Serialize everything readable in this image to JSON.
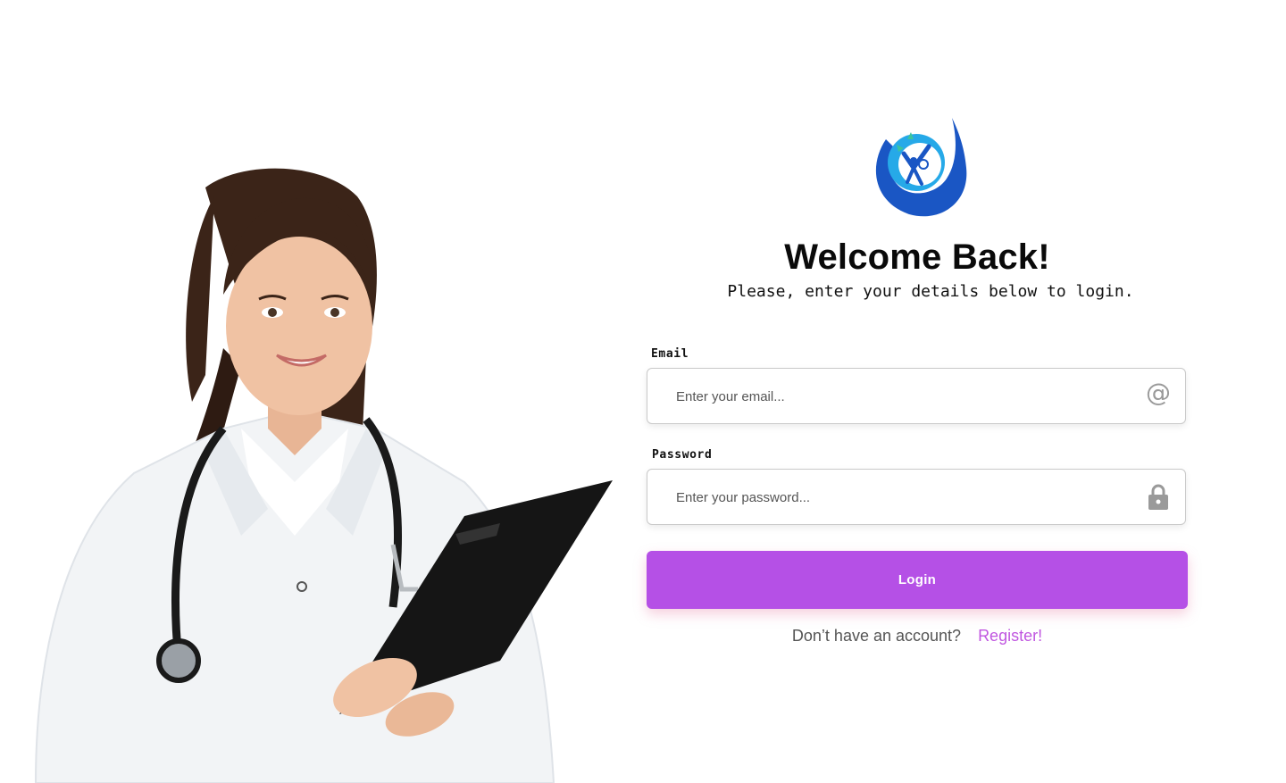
{
  "brand": {
    "logo_icon": "hand-care-logo-icon",
    "colors": {
      "primary": "#b550e6",
      "link": "#c056e0",
      "logo_blue": "#1a56c4",
      "logo_cyan": "#26a9e8"
    }
  },
  "header": {
    "title": "Welcome Back!",
    "subtitle": "Please, enter your details below to login."
  },
  "form": {
    "email": {
      "label": "Email",
      "placeholder": "Enter your email...",
      "value": "",
      "icon": "at-sign-icon"
    },
    "password": {
      "label": "Password",
      "placeholder": "Enter your password...",
      "value": "",
      "icon": "lock-icon"
    },
    "submit_label": "Login"
  },
  "footer": {
    "question": "Don’t have an account?",
    "register_link": "Register!"
  },
  "hero": {
    "image": "doctor-with-clipboard-image"
  }
}
